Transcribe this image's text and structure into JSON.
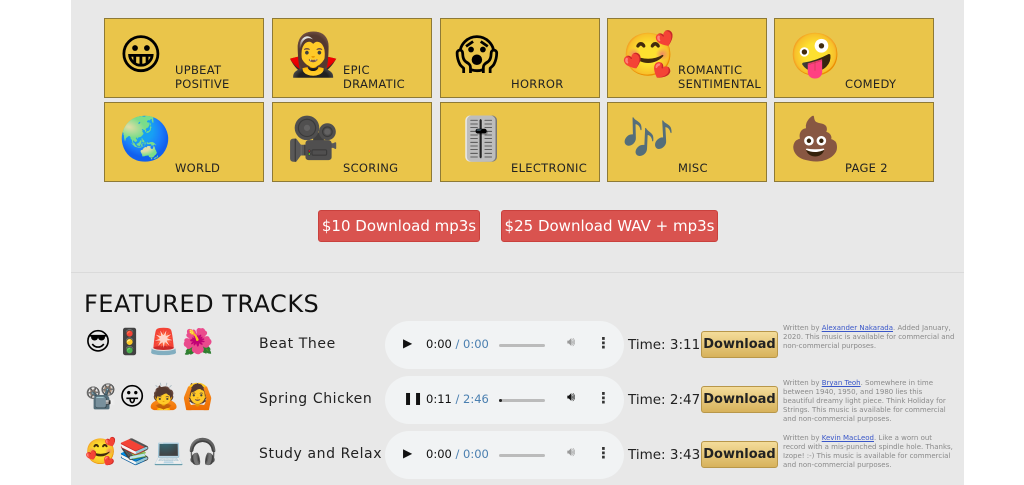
{
  "genres": [
    {
      "emoji": "😀",
      "label": "UPBEAT\nPOSITIVE"
    },
    {
      "emoji": "🧛‍♀️",
      "label": "EPIC\nDRAMATIC"
    },
    {
      "emoji": "😱",
      "label": "HORROR"
    },
    {
      "emoji": "🥰",
      "label": "ROMANTIC\nSENTIMENTAL"
    },
    {
      "emoji": "🤪",
      "label": "COMEDY"
    },
    {
      "emoji": "🌏",
      "label": "WORLD"
    },
    {
      "emoji": "🎥",
      "label": "SCORING"
    },
    {
      "emoji": "🎚️",
      "label": "ELECTRONIC"
    },
    {
      "emoji": "🎶",
      "label": "MISC"
    },
    {
      "emoji": "💩",
      "label": "PAGE 2"
    }
  ],
  "purchase": {
    "mp3_label": "$10 Download mp3s",
    "wav_label": "$25 Download WAV + mp3s",
    "color": "#d9534f"
  },
  "featured_title": "FEATURED TRACKS",
  "time_prefix": "Time:",
  "download_label": "Download",
  "tracks": [
    {
      "emojis": "😎🚦🚨🌺",
      "title": "Beat Thee",
      "current": "0:00",
      "duration": "0:00",
      "progress": 0,
      "playing": false,
      "time": "3:11",
      "credit_pre": "Written by ",
      "credit_author": "Alexander Nakarada",
      "credit_post": ". Added January, 2020. This music is available for commercial and non-commercial purposes."
    },
    {
      "emojis": "📽️😛🙇🙆",
      "title": "Spring Chicken",
      "current": "0:11",
      "duration": "2:46",
      "progress": 0.066,
      "playing": true,
      "time": "2:47",
      "credit_pre": "Written by ",
      "credit_author": "Bryan Teoh",
      "credit_post": ". Somewhere in time between 1940, 1950, and 1980 lies this beautiful dreamy light piece. Think Holiday for Strings. This music is available for commercial and non-commercial purposes."
    },
    {
      "emojis": "🥰📚💻🎧",
      "title": "Study and Relax",
      "current": "0:00",
      "duration": "0:00",
      "progress": 0,
      "playing": false,
      "time": "3:43",
      "credit_pre": "Written by ",
      "credit_author": "Kevin MacLeod",
      "credit_post": ". Like a worn out record with a mis-punched spindle hole. Thanks, Izope! :-) This music is available for commercial and non-commercial purposes."
    }
  ]
}
